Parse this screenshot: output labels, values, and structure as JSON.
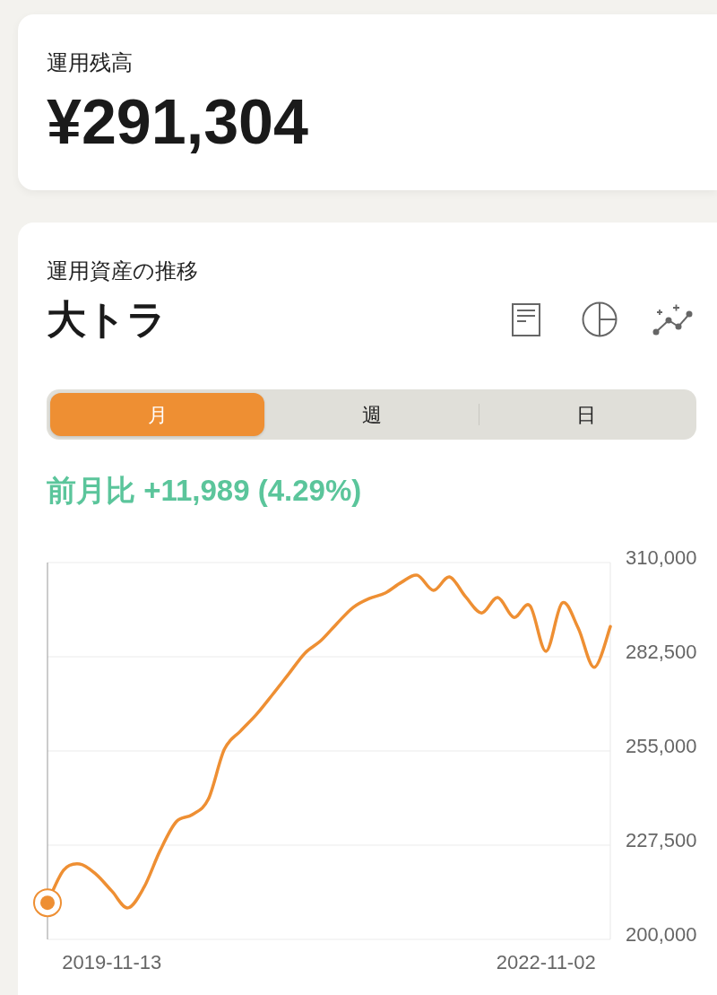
{
  "balance_card": {
    "label": "運用残高",
    "amount": "¥291,304"
  },
  "asset_card": {
    "subtitle": "運用資産の推移",
    "title": "大トラ",
    "period_tabs": [
      {
        "label": "月",
        "selected": true
      },
      {
        "label": "週",
        "selected": false
      },
      {
        "label": "日",
        "selected": false
      }
    ],
    "change": "前月比 +11,989 (4.29%)",
    "chart_data": {
      "type": "line",
      "grid": true,
      "categories": [
        null,
        null,
        null,
        null,
        "2019-11-13",
        null,
        null,
        null,
        null,
        null,
        null,
        null,
        null,
        null,
        null,
        null,
        null,
        null,
        null,
        null,
        null,
        null,
        null,
        null,
        null,
        null,
        null,
        null,
        null,
        null,
        null,
        "2022-11-02",
        null,
        null,
        null,
        null
      ],
      "series": [
        {
          "color": "#ee8f33",
          "values": [
            210700,
            220200,
            222000,
            219100,
            214100,
            209200,
            215200,
            225900,
            234300,
            236400,
            240900,
            255500,
            260800,
            265700,
            271500,
            277500,
            283500,
            287200,
            292200,
            296900,
            299500,
            301100,
            304200,
            306300,
            301900,
            305800,
            300000,
            295300,
            299800,
            294000,
            297400,
            284100,
            298200,
            290900,
            279400,
            291300
          ]
        }
      ],
      "ylim": [
        200000,
        310000
      ],
      "yticks": [
        {
          "value": 310000,
          "label": "310,000"
        },
        {
          "value": 282500,
          "label": "282,500"
        },
        {
          "value": 255000,
          "label": "255,000"
        },
        {
          "value": 227500,
          "label": "227,500"
        },
        {
          "value": 200000,
          "label": "200,000"
        }
      ]
    }
  }
}
